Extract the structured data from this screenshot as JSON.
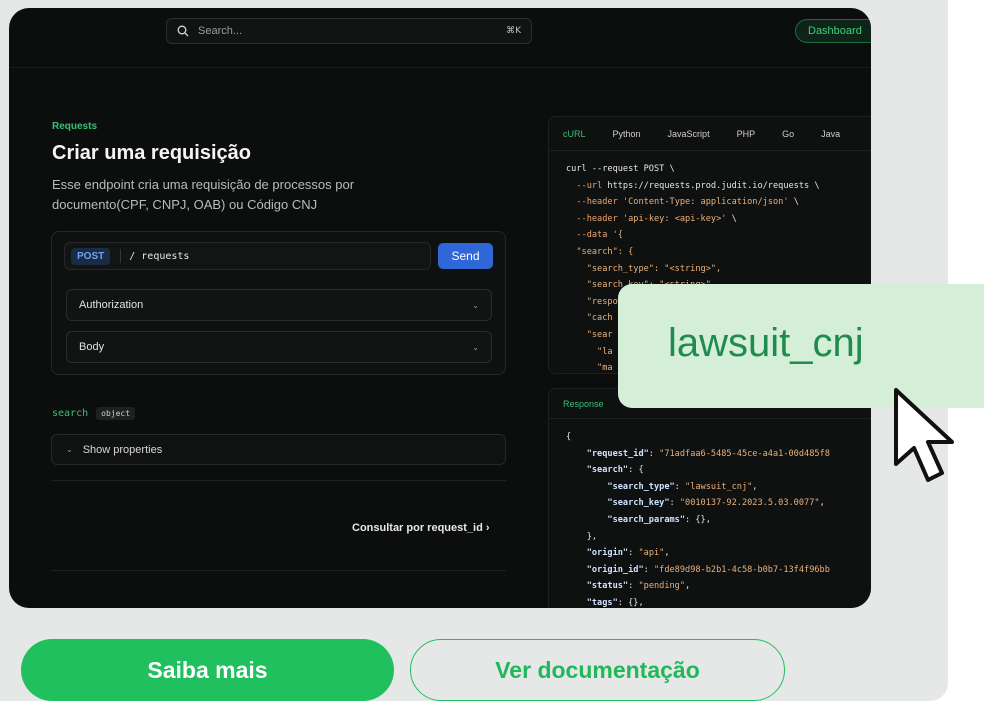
{
  "topbar": {
    "search_placeholder": "Search...",
    "search_shortcut": "⌘K",
    "dashboard_label": "Dashboard"
  },
  "main": {
    "section_label": "Requests",
    "title": "Criar uma requisição",
    "description": "Esse endpoint cria uma requisição de processos por documento(CPF, CNPJ, OAB) ou Código CNJ",
    "request": {
      "method": "POST",
      "path": "/ requests",
      "send_label": "Send",
      "accordions": [
        "Authorization",
        "Body"
      ]
    },
    "property": {
      "name": "search",
      "type": "object",
      "show_label": "Show properties"
    },
    "next_link": "Consultar por request_id  ›"
  },
  "code_panel": {
    "tabs": [
      "cURL",
      "Python",
      "JavaScript",
      "PHP",
      "Go",
      "Java"
    ],
    "active_tab": "cURL"
  },
  "response_panel": {
    "tab": "Response"
  },
  "tooltip": {
    "text": "lawsuit_cnj"
  },
  "cta": {
    "primary": "Saiba mais",
    "secondary": "Ver documentação"
  },
  "colors": {
    "accent": "#20c05f",
    "send": "#2f66d8",
    "screen_bg": "#0c0d0d",
    "tooltip_bg": "#d4eed8"
  }
}
